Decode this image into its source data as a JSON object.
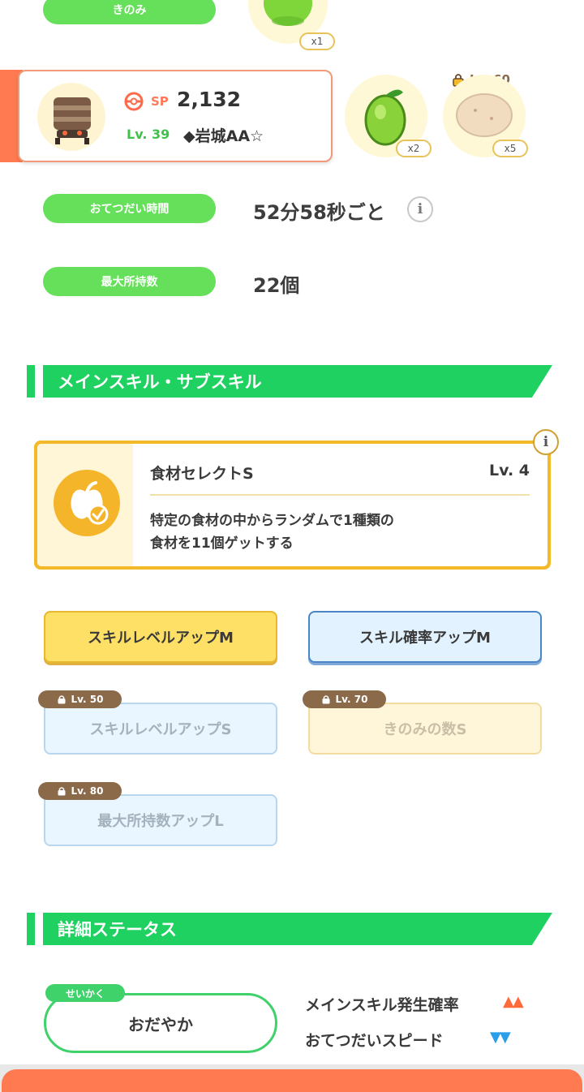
{
  "berry": {
    "label": "きのみ",
    "qty": "x1"
  },
  "profile": {
    "sp_label": "SP",
    "sp_value": "2,132",
    "level": "Lv. 39",
    "name": "◆岩城AA☆"
  },
  "ingredients": [
    {
      "qty": "x2",
      "icon": "avocado-icon"
    },
    {
      "lock": "Lv. 60",
      "qty": "x5",
      "icon": "potato-icon"
    }
  ],
  "help_time": {
    "label": "おてつだい時間",
    "value": "52分58秒ごと"
  },
  "max_carry": {
    "label": "最大所持数",
    "value": "22個"
  },
  "skills_section": {
    "title": "メインスキル・サブスキル"
  },
  "main_skill": {
    "name": "食材セレクトS",
    "level": "Lv. 4",
    "desc_line1": "特定の食材の中からランダムで1種類の",
    "desc_line2": "食材を11個ゲットする"
  },
  "sub_skills": [
    {
      "label": "スキルレベルアップM"
    },
    {
      "label": "スキル確率アップM"
    },
    {
      "label": "スキルレベルアップS",
      "lock": "Lv. 50"
    },
    {
      "label": "きのみの数S",
      "lock": "Lv. 70"
    },
    {
      "label": "最大所持数アップL",
      "lock": "Lv. 80"
    }
  ],
  "details_section": {
    "title": "詳細ステータス"
  },
  "nature": {
    "tag": "せいかく",
    "value": "おだやか",
    "up_label": "メインスキル発生確率",
    "up_marks": "▲▲",
    "down_label": "おてつだいスピード",
    "down_marks": "▼▼"
  },
  "colors": {
    "green": "#66e05a",
    "section_green": "#1fd160",
    "accent_orange": "#ff7a50",
    "gold": "#f3b928"
  }
}
